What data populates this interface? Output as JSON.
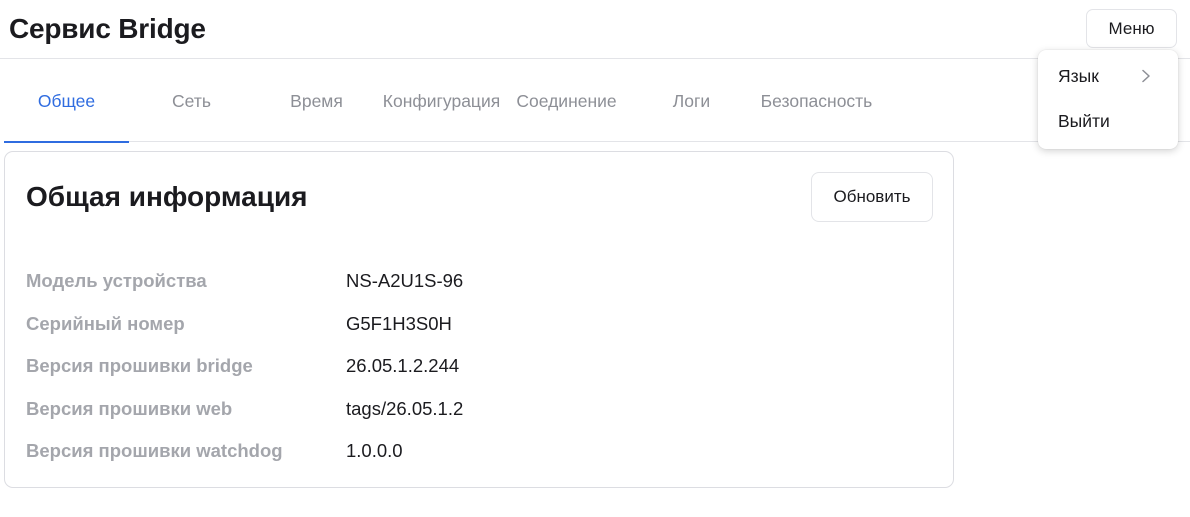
{
  "header": {
    "title": "Сервис Bridge",
    "menu_label": "Меню"
  },
  "tabs": [
    {
      "label": "Общее",
      "active": true
    },
    {
      "label": "Сеть",
      "active": false
    },
    {
      "label": "Время",
      "active": false
    },
    {
      "label": "Конфигурация",
      "active": false
    },
    {
      "label": "Соединение",
      "active": false
    },
    {
      "label": "Логи",
      "active": false
    },
    {
      "label": "Безопасность",
      "active": false
    }
  ],
  "card": {
    "title": "Общая информация",
    "refresh_label": "Обновить",
    "rows": [
      {
        "label": "Модель устройства",
        "value": "NS-A2U1S-96"
      },
      {
        "label": "Серийный номер",
        "value": "G5F1H3S0H"
      },
      {
        "label": "Версия прошивки bridge",
        "value": "26.05.1.2.244"
      },
      {
        "label": "Версия прошивки web",
        "value": "tags/26.05.1.2"
      },
      {
        "label": "Версия прошивки watchdog",
        "value": "1.0.0.0"
      }
    ]
  },
  "dropdown": {
    "language_label": "Язык",
    "logout_label": "Выйти"
  },
  "colors": {
    "accent": "#2f6ce0",
    "muted_text": "#8d8f96",
    "label_text": "#a4a6ac",
    "border": "#e3e4e8"
  }
}
